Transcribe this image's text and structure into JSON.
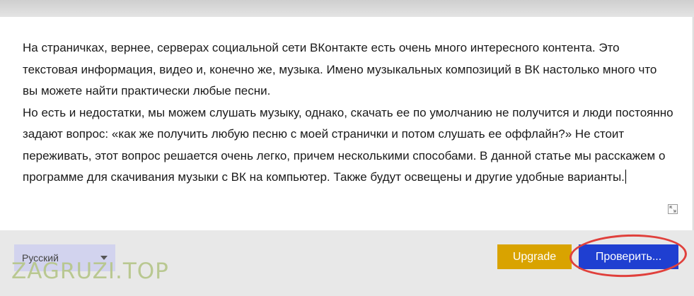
{
  "editor": {
    "paragraphs": [
      "На страничках, вернее, серверах социальной сети ВКонтакте есть очень много интересного контента. Это текстовая информация, видео и, конечно же, музыка. Имено музыкальных композиций в ВК настолько много что вы можете найти практически любые песни.",
      "Но есть и недостатки, мы можем слушать музыку, однако, скачать ее по умолчанию не получится и люди постоянно задают вопрос: «как же получить любую песню с моей странички и потом слушать ее оффлайн?» Не стоит переживать, этот вопрос решается очень легко, причем несколькими способами. В данной статье мы расскажем о программе для скачивания музыки с ВК на компьютер. Также будут освещены и другие удобные варианты."
    ],
    "resize_icon": "resize-icon"
  },
  "language": {
    "selected": "Русский"
  },
  "buttons": {
    "upgrade": "Upgrade",
    "check": "Проверить..."
  },
  "watermark": {
    "text": "ZAGRUZI.TOP"
  },
  "colors": {
    "upgrade": "#d9a300",
    "check": "#1f3fd1",
    "highlight": "#e0403c",
    "language_bg": "#d2d3ee"
  }
}
